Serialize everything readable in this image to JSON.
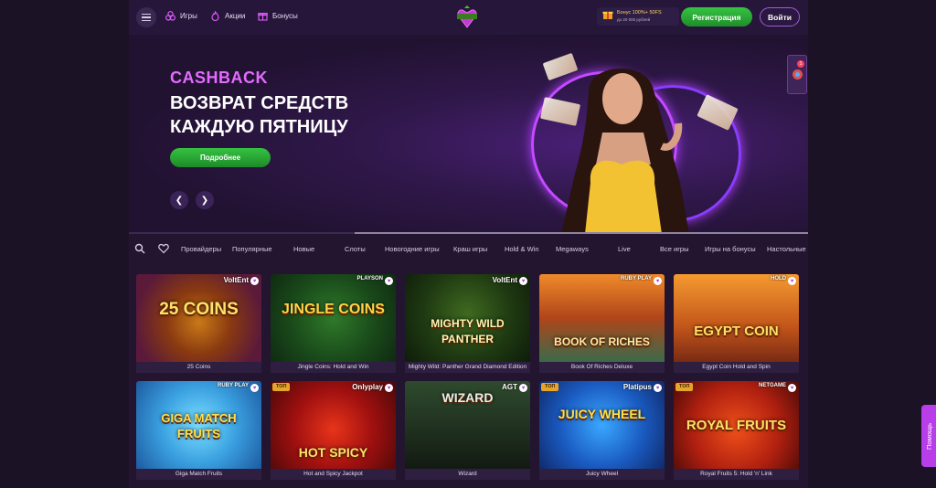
{
  "header": {
    "nav": [
      {
        "label": "Игры",
        "icon": "games-icon"
      },
      {
        "label": "Акции",
        "icon": "fire-icon"
      },
      {
        "label": "Бонусы",
        "icon": "gift-icon"
      }
    ],
    "bonus_title": "Бонус 100%+ 50FS",
    "bonus_sub": "до 20 000 рублей",
    "register_label": "Регистрация",
    "login_label": "Войти"
  },
  "banner": {
    "kicker": "CASHBACK",
    "line1": "ВОЗВРАТ СРЕДСТВ",
    "line2": "КАЖДУЮ ПЯТНИЦУ",
    "cta_label": "Подробнее",
    "progress": 0.667
  },
  "side_widget": {
    "badge": "1"
  },
  "help_label": "Помощь",
  "categories": [
    "Провайдеры",
    "Популярные",
    "Новые",
    "Слоты",
    "Новогодние игры",
    "Краш игры",
    "Hold & Win",
    "Megaways",
    "Live",
    "Все игры",
    "Игры на бонусы",
    "Настольные"
  ],
  "games": [
    {
      "name": "25 Coins",
      "title": "25 COINS",
      "provider": "VoltEnt",
      "badge": ""
    },
    {
      "name": "Jingle Coins: Hold and Win",
      "title": "JINGLE COINS",
      "provider": "PLAYSON",
      "badge": ""
    },
    {
      "name": "Mighty Wild: Panther Grand Diamond Edition",
      "title": "MIGHTY WILD PANTHER",
      "provider": "VoltEnt",
      "badge": ""
    },
    {
      "name": "Book Of Riches Deluxe",
      "title": "BOOK OF RICHES",
      "provider": "RUBY PLAY",
      "badge": ""
    },
    {
      "name": "Egypt Coin Hold and Spin",
      "title": "EGYPT COIN",
      "provider": "HOLD",
      "badge": ""
    },
    {
      "name": "Giga Match Fruits",
      "title": "GIGA MATCH FRUITS",
      "provider": "RUBY PLAY",
      "badge": ""
    },
    {
      "name": "Hot and Spicy Jackpot",
      "title": "HOT SPICY",
      "provider": "Onlyplay",
      "badge": "ТОП"
    },
    {
      "name": "Wizard",
      "title": "WIZARD",
      "provider": "AGT",
      "badge": ""
    },
    {
      "name": "Juicy Wheel",
      "title": "JUICY WHEEL",
      "provider": "Platipus",
      "badge": "ТОП"
    },
    {
      "name": "Royal Fruits 5: Hold 'n' Link",
      "title": "ROYAL FRUITS",
      "provider": "NETGAME",
      "badge": "ТОП"
    }
  ],
  "colors": {
    "accent": "#b73ee8",
    "green": "#2fae3b",
    "bg": "#1c1226"
  }
}
